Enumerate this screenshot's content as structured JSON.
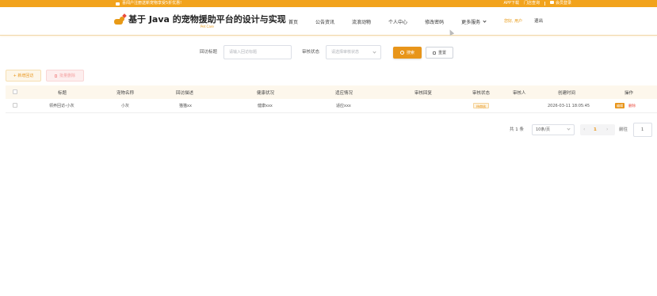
{
  "topbar": {
    "announcement": "喜闻户注册送新宠物享受5折优惠!",
    "links": [
      "APP下载",
      "门店查询",
      "会员登录"
    ]
  },
  "header": {
    "logo_title": "基于 Java 的宠物援助平台的设计与实现",
    "logo_subtitle": "Pet Care",
    "nav": [
      "首页",
      "公告资讯",
      "流浪动物",
      "个人中心",
      "修改密码",
      "更多服务"
    ],
    "greeting": "您好, 用户",
    "logout": "退出"
  },
  "search": {
    "title_label": "回访标题",
    "title_placeholder": "请输入回访标题",
    "status_label": "审核状态",
    "status_placeholder": "请选择审核状态",
    "search_button": "搜索",
    "reset_button": "重置"
  },
  "actions": {
    "add_label": "+ 新增回访",
    "delete_label": "批量删除"
  },
  "table": {
    "columns": [
      "标题",
      "宠物名称",
      "回访描述",
      "健康状况",
      "适应情况",
      "审核回复",
      "审核状态",
      "审核人",
      "创建时间",
      "操作"
    ],
    "rows": [
      {
        "title": "领养回访-小灰",
        "pet": "小灰",
        "desc": "猫猫xx",
        "health": "健康xxx",
        "adapt": "适应xxx",
        "reply": "",
        "status": "待审核",
        "reviewer": "",
        "created": "2026-03-11 18:05:45",
        "edit": "编辑",
        "delete": "删除"
      }
    ]
  },
  "pagination": {
    "total": "共 1 条",
    "page_size": "10条/页",
    "prev": "‹",
    "current": "1",
    "next": "›",
    "goto_label": "前往",
    "goto_value": "1"
  },
  "colors": {
    "accent": "#e8951a",
    "topbar": "#f2a31c",
    "danger": "#e94b3c"
  }
}
